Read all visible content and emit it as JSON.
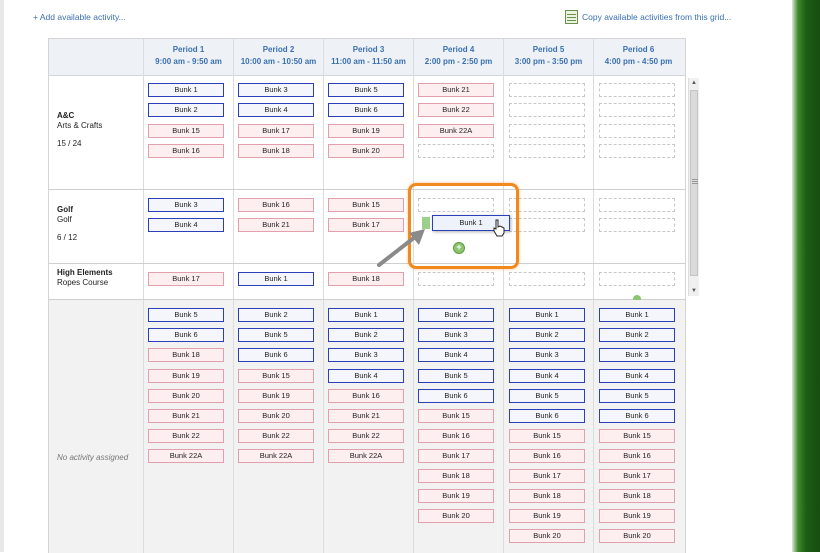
{
  "links": {
    "add_activity": "+ Add available activity...",
    "copy_activities": "Copy available activities from this grid..."
  },
  "periods": [
    {
      "name": "Period 1",
      "time": "9:00 am - 9:50 am"
    },
    {
      "name": "Period 2",
      "time": "10:00 am - 10:50 am"
    },
    {
      "name": "Period 3",
      "time": "11:00 am - 11:50 am"
    },
    {
      "name": "Period 4",
      "time": "2:00 pm - 2:50 pm"
    },
    {
      "name": "Period 5",
      "time": "3:00 pm - 3:50 pm"
    },
    {
      "name": "Period 6",
      "time": "4:00 pm - 4:50 pm"
    }
  ],
  "activities": [
    {
      "name": "A&C",
      "sub": "Arts & Crafts",
      "count": "15 / 24"
    },
    {
      "name": "Golf",
      "sub": "Golf",
      "count": "6 / 12"
    },
    {
      "name": "High Elements",
      "sub": "Ropes Course",
      "count": ""
    }
  ],
  "unassigned_label": "No activity assigned",
  "dragging_bunk": "Bunk 1",
  "colors": {
    "accent": "#3a6fb0",
    "highlight": "#f08a1f",
    "blue_border": "#2a3fb8",
    "pink_border": "#e2a0ac"
  },
  "icons": {
    "copy": "spreadsheet-icon",
    "add": "plus-circle-icon",
    "cursor": "hand-cursor-icon",
    "pointer": "arrow-icon"
  }
}
